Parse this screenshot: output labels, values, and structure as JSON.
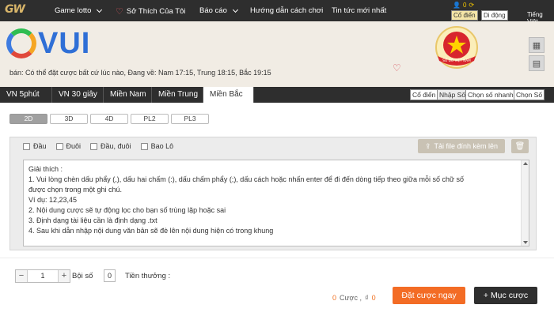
{
  "topnav": {
    "logo": "GW",
    "items": [
      {
        "label": "Game lotto",
        "has_dropdown": true
      },
      {
        "label": "Sở Thích Của Tôi",
        "has_dropdown": false
      },
      {
        "label": "Báo cáo",
        "has_dropdown": true
      },
      {
        "label": "Hướng dẫn cách chơi",
        "has_dropdown": false
      },
      {
        "label": "Tin tức mới nhất",
        "has_dropdown": false
      }
    ],
    "balance": "0",
    "mode_classic": "Cổ điển",
    "mode_mobile": "Di động",
    "language": "Tiếng Việt"
  },
  "header": {
    "brand": "VUI",
    "brand_initial": "G",
    "notice": "bán: Có thể đặt cược bất cứ lúc nào,   Đang về: Nam 17:15, Trung 18:15, Bắc 19:15",
    "badge_text": "SỐ ĐỎ VIỆT NAM"
  },
  "game_tabs": [
    "VN 5phút",
    "VN 30 giây",
    "Miền Nam",
    "Miền Trung",
    "Miền Bắc"
  ],
  "game_tab_active": "Miền Bắc",
  "right_tabs": [
    "Cổ điển",
    "Nhập Số",
    "Chọn số nhanh",
    "Chọn Số"
  ],
  "right_tab_active": "Nhập Số",
  "sub_tabs": [
    "2D",
    "3D",
    "4D",
    "PL2",
    "PL3"
  ],
  "sub_tab_active": "2D",
  "checkboxes": [
    "Đầu",
    "Đuôi",
    "Đầu, đuôi",
    "Bao Lô"
  ],
  "upload_label": "Tải file đính kèm lên",
  "instructions": [
    "Giải thích :",
    "1. Vui lòng chèn dấu phẩy (,), dấu hai chấm (:), dấu chấm phẩy (;), dấu cách hoặc nhấn enter để đi đến dòng tiếp theo giữa mỗi số chữ số",
    "được chọn trong một ghi chú.",
    "Ví dụ: 12,23,45",
    "2. Nội dung cược sẽ tự động lọc cho bạn số trùng lặp hoặc sai",
    "3. Định dạng tài liệu cần là định dạng .txt",
    "4. Sau khi dẫn nhập nội dung văn bản sẽ đè lên nội dung hiện có trong khung"
  ],
  "footer": {
    "stepper_value": "1",
    "multiplier_label": "Bội số",
    "multiplier_value": "0",
    "reward_label": "Tiền thưởng :",
    "bet_count": "0",
    "bet_count_label": "Cược ,",
    "amount_prefix": "₫",
    "amount": "0",
    "place_bet_label": "Đặt cược ngay",
    "add_bet_label": "+ Mục cược"
  },
  "colors": {
    "topbar": "#2e2e2e",
    "header_bg": "#f1ece4",
    "accent_orange": "#f36c25",
    "dark_button": "#2f2f2f"
  }
}
